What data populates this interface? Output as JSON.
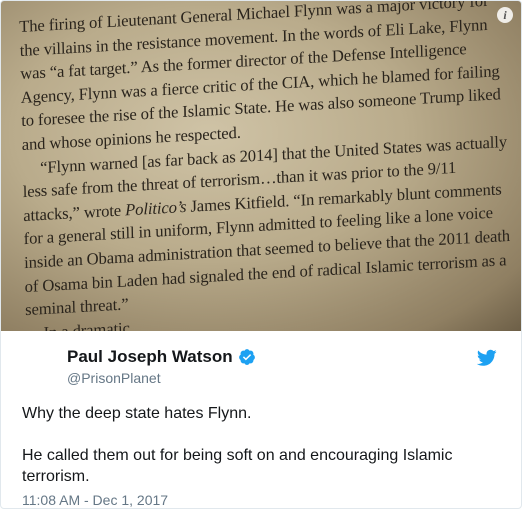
{
  "photo": {
    "paragraphs": [
      "The firing of Lieutenant General Michael Flynn was a major victory for the villains in the resistance movement. In the words of Eli Lake, Flynn was “a fat target.” As the former director of the Defense Intelligence Agency, Flynn was a fierce critic of the CIA, which he blamed for failing to foresee the rise of the Islamic State. He was also someone Trump liked and whose opinions he respected.",
      "“Flynn warned [as far back as 2014] that the United States was actually less safe from the threat of terrorism…than it was prior to the 9/11 attacks,” wrote",
      "Politico’s",
      "James Kitfield. “In remarkably blunt comments for a general still in uniform, Flynn admitted to feeling like a lone voice inside an Obama administration that seemed to believe that the 2011 death of Osama bin Laden had signaled the end of radical Islamic terrorism as a seminal threat.”",
      "In a dramatic"
    ],
    "info_icon": "info-icon"
  },
  "tweet": {
    "display_name": "Paul Joseph Watson",
    "handle": "@PrisonPlanet",
    "text_line1": "Why the deep state hates Flynn.",
    "text_line2": "He called them out for being soft on and encouraging Islamic terrorism.",
    "timestamp": "11:08 AM - Dec 1, 2017",
    "verified_icon": "verified-badge-icon",
    "brand_icon": "twitter-bird-icon",
    "colors": {
      "brand": "#1da1f2",
      "name": "#14171a",
      "muted": "#657786"
    }
  }
}
